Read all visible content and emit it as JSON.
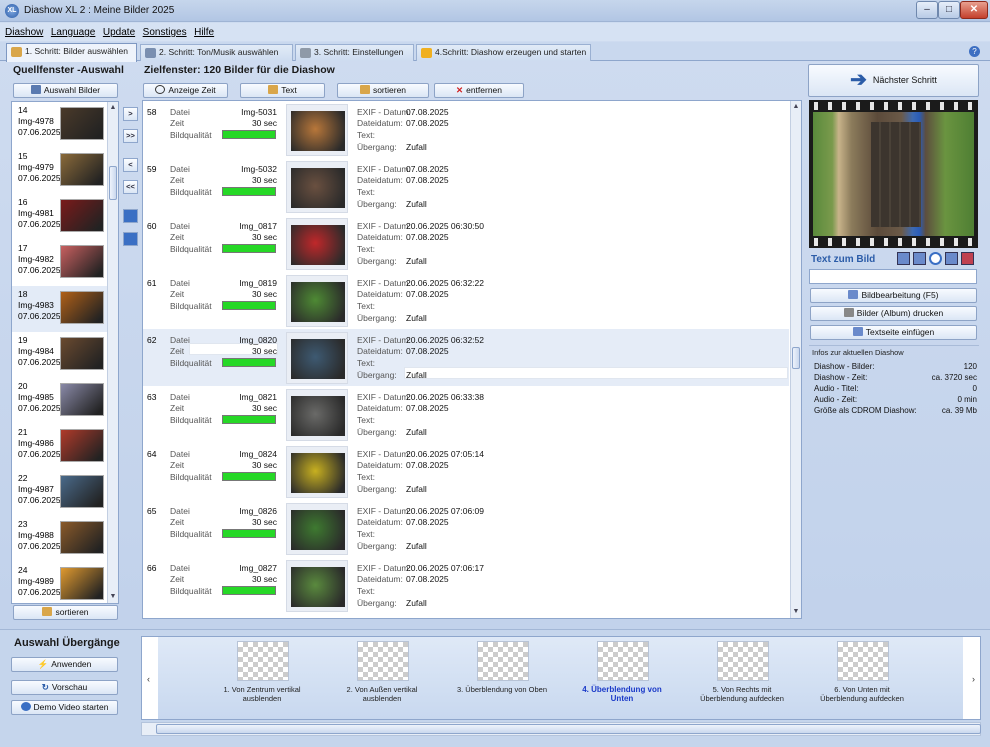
{
  "window": {
    "title": "Diashow XL 2 : Meine Bilder 2025",
    "icon": "XL"
  },
  "menu": [
    "Diashow",
    "Language",
    "Update",
    "Sonstiges",
    "Hilfe"
  ],
  "tabs": [
    {
      "label": "1. Schritt: Bilder auswählen",
      "active": true
    },
    {
      "label": "2. Schritt: Ton/Musik auswählen"
    },
    {
      "label": "3. Schritt: Einstellungen"
    },
    {
      "label": "4.Schritt: Diashow erzeugen und starten"
    }
  ],
  "source": {
    "title": "Quellfenster -Auswahl",
    "select_button": "Auswahl Bilder",
    "sort_button": "sortieren",
    "items": [
      {
        "num": "14",
        "name": "Img-4978",
        "date": "07.06.2025",
        "color": "#4a3a2a"
      },
      {
        "num": "15",
        "name": "Img-4979",
        "date": "07.06.2025",
        "color": "#8a6a3a"
      },
      {
        "num": "16",
        "name": "Img-4981",
        "date": "07.06.2025",
        "color": "#7a1a1a"
      },
      {
        "num": "17",
        "name": "Img-4982",
        "date": "07.06.2025",
        "color": "#c86060"
      },
      {
        "num": "18",
        "name": "Img-4983",
        "date": "07.06.2025",
        "color": "#b06018",
        "selected": true
      },
      {
        "num": "19",
        "name": "Img-4984",
        "date": "07.06.2025",
        "color": "#6a4a30"
      },
      {
        "num": "20",
        "name": "Img-4985",
        "date": "07.06.2025",
        "color": "#8a8aa8"
      },
      {
        "num": "21",
        "name": "Img-4986",
        "date": "07.06.2025",
        "color": "#b03a2a"
      },
      {
        "num": "22",
        "name": "Img-4987",
        "date": "07.06.2025",
        "color": "#4a6a8a"
      },
      {
        "num": "23",
        "name": "Img-4988",
        "date": "07.06.2025",
        "color": "#8a5a2a"
      },
      {
        "num": "24",
        "name": "Img-4989",
        "date": "07.06.2025",
        "color": "#e09a30"
      }
    ]
  },
  "nav_buttons": [
    ">",
    ">>",
    "<",
    "<<"
  ],
  "target": {
    "title": "Zielfenster: 120 Bilder für die Diashow",
    "toolbar": {
      "time": "Anzeige Zeit",
      "text": "Text",
      "sort": "sortieren",
      "remove": "entfernen"
    },
    "labels": {
      "datei": "Datei",
      "zeit": "Zeit",
      "quality": "Bildqualität",
      "exif": "EXIF - Datum:",
      "dateidatum": "Dateidatum:",
      "text": "Text:",
      "uebergang": "Übergang:"
    },
    "rows": [
      {
        "n": "58",
        "file": "Img-5031",
        "time": "30 sec",
        "exif": "07.08.2025",
        "date": "07.08.2025",
        "trans": "Zufall",
        "color": "#b8773a"
      },
      {
        "n": "59",
        "file": "Img-5032",
        "time": "30 sec",
        "exif": "07.08.2025",
        "date": "07.08.2025",
        "trans": "Zufall",
        "color": "#6a5040"
      },
      {
        "n": "60",
        "file": "Img_0817",
        "time": "30 sec",
        "exif": "20.06.2025 06:30:50",
        "date": "07.08.2025",
        "trans": "Zufall",
        "color": "#c0282a"
      },
      {
        "n": "61",
        "file": "Img_0819",
        "time": "30 sec",
        "exif": "20.06.2025 06:32:22",
        "date": "07.08.2025",
        "trans": "Zufall",
        "color": "#4e8a34"
      },
      {
        "n": "62",
        "file": "Img_0820",
        "time": "30 sec",
        "exif": "20.06.2025 06:32:52",
        "date": "07.08.2025",
        "trans": "Zufall",
        "color": "#3e5a72",
        "selected": true
      },
      {
        "n": "63",
        "file": "Img_0821",
        "time": "30 sec",
        "exif": "20.06.2025 06:33:38",
        "date": "07.08.2025",
        "trans": "Zufall",
        "color": "#6a6a68"
      },
      {
        "n": "64",
        "file": "Img_0824",
        "time": "30 sec",
        "exif": "20.06.2025 07:05:14",
        "date": "07.08.2025",
        "trans": "Zufall",
        "color": "#c8b020"
      },
      {
        "n": "65",
        "file": "Img_0826",
        "time": "30 sec",
        "exif": "20.06.2025 07:06:09",
        "date": "07.08.2025",
        "trans": "Zufall",
        "color": "#3e7a30"
      },
      {
        "n": "66",
        "file": "Img_0827",
        "time": "30 sec",
        "exif": "20.06.2025 07:06:17",
        "date": "07.08.2025",
        "trans": "Zufall",
        "color": "#5a8a3e"
      }
    ]
  },
  "right": {
    "next_step": "Nächster Schritt",
    "text_to_image": "Text zum Bild",
    "edit": "Bildbearbeitung (F5)",
    "print": "Bilder (Album) drucken",
    "text_page": "Textseite einfügen",
    "info_title": "Infos zur aktuellen Diashow",
    "info": [
      {
        "label": "Diashow - Bilder:",
        "value": "120"
      },
      {
        "label": "Diashow - Zeit:",
        "value": "ca. 3720 sec"
      },
      {
        "label": "Audio - Titel:",
        "value": "0"
      },
      {
        "label": "Audio - Zeit:",
        "value": "0 min"
      },
      {
        "label": "Größe als CDROM Diashow:",
        "value": "ca. 39 Mb"
      }
    ]
  },
  "transitions": {
    "title": "Auswahl Übergänge",
    "apply": "Anwenden",
    "preview": "Vorschau",
    "demo": "Demo Video starten",
    "items": [
      {
        "label": "1. Von Zentrum vertikal ausblenden"
      },
      {
        "label": "2. Von Außen vertikal ausblenden"
      },
      {
        "label": "3. Überblendung von Oben"
      },
      {
        "label": "4. Überblendung von Unten",
        "active": true
      },
      {
        "label": "5. Von Rechts mit Überblendung aufdecken"
      },
      {
        "label": "6. Von Unten mit Überblendung aufdecken"
      }
    ]
  },
  "colors": {
    "accent": "#2b5ca8",
    "quality_bar": "#26d826",
    "active_transition": "#1a39c8"
  }
}
